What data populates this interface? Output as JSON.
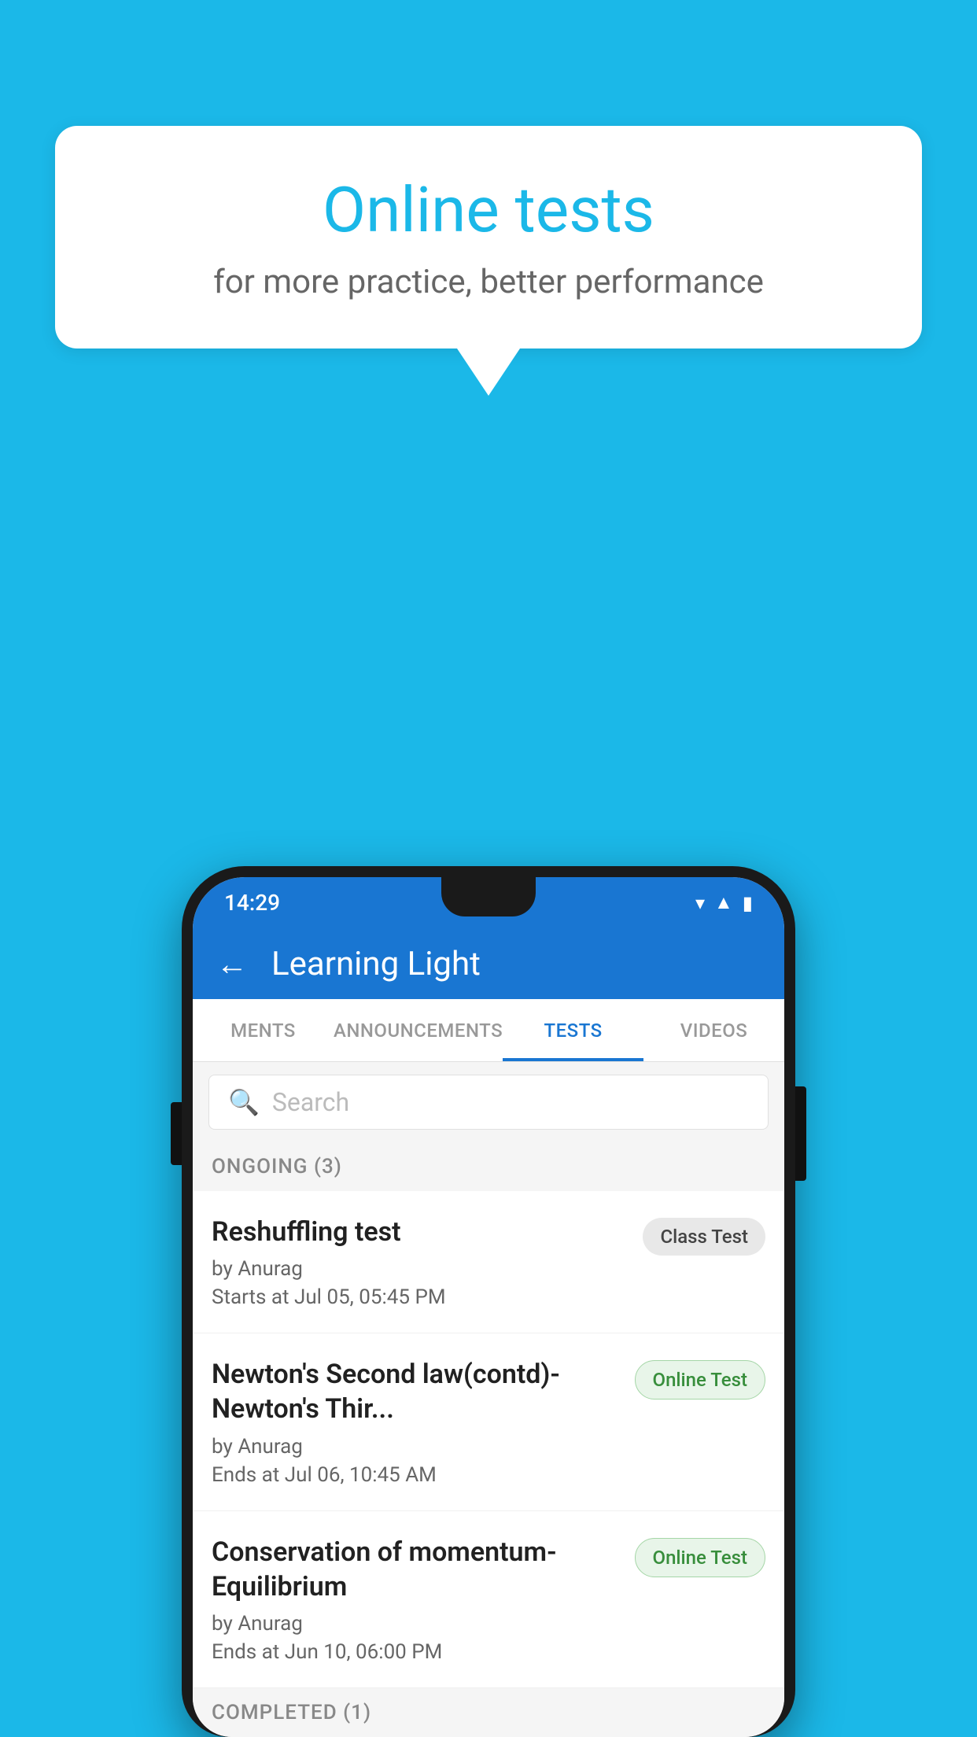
{
  "background_color": "#1BB8E8",
  "speech_bubble": {
    "title": "Online tests",
    "subtitle": "for more practice, better performance"
  },
  "phone": {
    "status_bar": {
      "time": "14:29",
      "icons": [
        "wifi",
        "signal",
        "battery"
      ]
    },
    "app_header": {
      "title": "Learning Light",
      "back_label": "←"
    },
    "tabs": [
      {
        "label": "MENTS",
        "active": false
      },
      {
        "label": "ANNOUNCEMENTS",
        "active": false
      },
      {
        "label": "TESTS",
        "active": true
      },
      {
        "label": "VIDEOS",
        "active": false
      }
    ],
    "search": {
      "placeholder": "Search"
    },
    "ongoing_section": {
      "label": "ONGOING (3)",
      "tests": [
        {
          "name": "Reshuffling test",
          "author": "by Anurag",
          "time": "Starts at  Jul 05, 05:45 PM",
          "badge": "Class Test",
          "badge_type": "class"
        },
        {
          "name": "Newton's Second law(contd)-Newton's Thir...",
          "author": "by Anurag",
          "time": "Ends at  Jul 06, 10:45 AM",
          "badge": "Online Test",
          "badge_type": "online"
        },
        {
          "name": "Conservation of momentum-Equilibrium",
          "author": "by Anurag",
          "time": "Ends at  Jun 10, 06:00 PM",
          "badge": "Online Test",
          "badge_type": "online"
        }
      ]
    },
    "completed_section": {
      "label": "COMPLETED (1)"
    }
  }
}
